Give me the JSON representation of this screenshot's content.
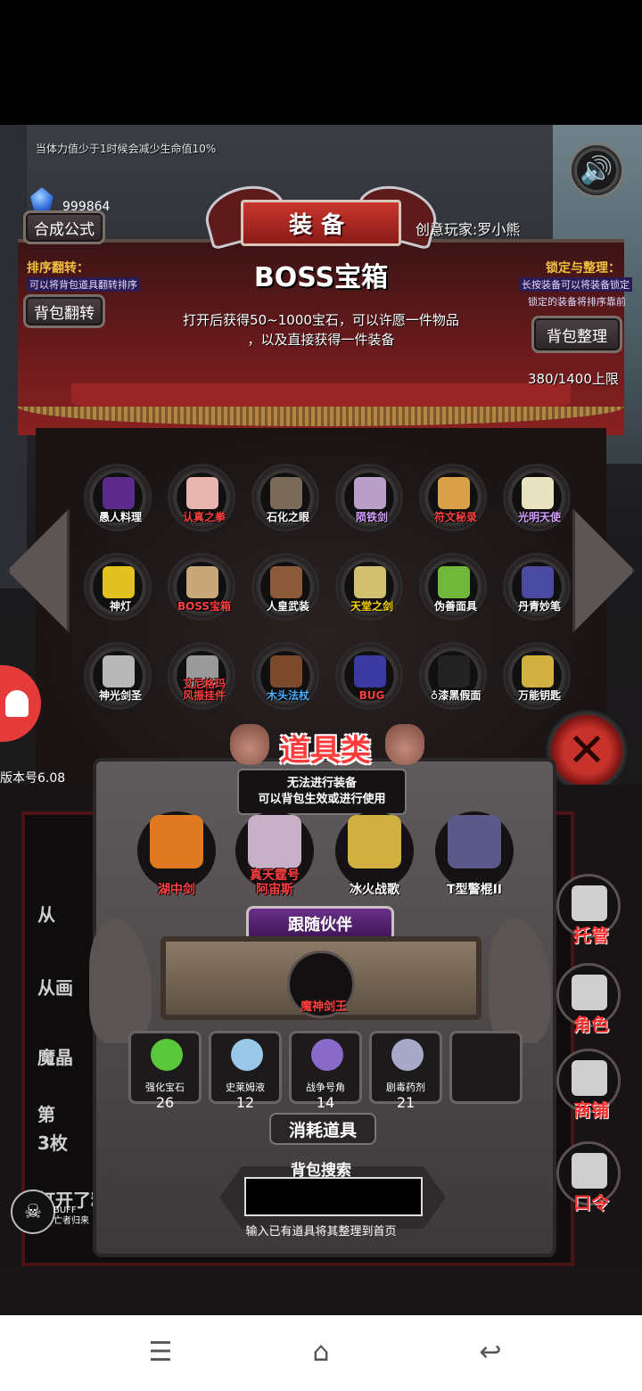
{
  "hint": "当体力值少于1时候会减少生命值10%",
  "gem_count": "999864",
  "header": {
    "title": "装备",
    "player": "创意玩家:罗小熊",
    "synth_button": "合成公式",
    "flip_button": "背包翻转",
    "sort_button": "背包整理",
    "sort_label": "排序翻转：",
    "sort_desc": "可以将背包道具翻转排序",
    "lock_label": "锁定与整理：",
    "lock_desc1": "长按装备可以将装备锁定",
    "lock_desc2": "锁定的装备将排序靠前",
    "capacity": "380/1400上限"
  },
  "selected_item": {
    "title": "BOSS宝箱",
    "desc_line1": "打开后获得50~1000宝石，可以许愿一件物品",
    "desc_line2": "，以及直接获得一件装备"
  },
  "items": [
    {
      "label": "愚人料理",
      "color": "#ffffff",
      "art": "#5b2a8a"
    },
    {
      "label": "认真之拳",
      "color": "#ff4040",
      "art": "#e7b6b0"
    },
    {
      "label": "石化之眼",
      "color": "#ffffff",
      "art": "#7a6a5a"
    },
    {
      "label": "陨铁剑",
      "color": "#d7a0ff",
      "art": "#b9a0c9"
    },
    {
      "label": "符文秘录",
      "color": "#ff4040",
      "art": "#d9a04a"
    },
    {
      "label": "光明天使",
      "color": "#d7a0ff",
      "art": "#e8e2c0"
    },
    {
      "label": "神灯",
      "color": "#ffffff",
      "art": "#e2c020"
    },
    {
      "label": "BOSS宝箱",
      "color": "#ff4040",
      "art": "#c9a878"
    },
    {
      "label": "人皇武装",
      "color": "#ffffff",
      "art": "#8a5a3a"
    },
    {
      "label": "天堂之剑",
      "color": "#ffd700",
      "art": "#d0c070"
    },
    {
      "label": "伪善面具",
      "color": "#ffffff",
      "art": "#6fb83a"
    },
    {
      "label": "丹青妙笔",
      "color": "#ffffff",
      "art": "#4a4aa0"
    },
    {
      "label": "神光剑圣",
      "color": "#ffffff",
      "art": "#b8b8b8"
    },
    {
      "label": "艾尼格玛\n风振挂件",
      "color": "#ff4040",
      "art": "#9a9a9a"
    },
    {
      "label": "木头法杖",
      "color": "#4ab0ff",
      "art": "#7a4a2a"
    },
    {
      "label": "BUG",
      "color": "#ff4040",
      "art": "#3a3aa0"
    },
    {
      "label": "♁漆黑假面",
      "color": "#ffffff",
      "art": "#222222"
    },
    {
      "label": "万能钥匙",
      "color": "#ffffff",
      "art": "#d0b040"
    }
  ],
  "version": "版本号6.08",
  "log_lines": [
    "从",
    "从画",
    "魔晶",
    "第",
    "3枚",
    "打开了精致的宝箱"
  ],
  "tools": {
    "title": "道具类",
    "desc_line1": "无法进行装备",
    "desc_line2": "可以背包生效或进行使用",
    "list": [
      {
        "label": "湖中剑",
        "color": "#ff4040",
        "art": "#e07a20"
      },
      {
        "label": "真天霆号\n阿宙斯",
        "color": "#ff4040",
        "art": "#c9b0c9"
      },
      {
        "label": "冰火战歌",
        "color": "#ffffff",
        "art": "#d0b040"
      },
      {
        "label": "T型警棍II",
        "color": "#ffffff",
        "art": "#5a5a8a"
      }
    ]
  },
  "partner": {
    "ribbon": "跟随伙伴",
    "name": "魔神剑王"
  },
  "consumables": [
    {
      "label": "强化宝石",
      "count": "26",
      "art": "#5ac83a"
    },
    {
      "label": "史莱姆液",
      "count": "12",
      "art": "#9ac8e8"
    },
    {
      "label": "战争号角",
      "count": "14",
      "art": "#8a6ac8"
    },
    {
      "label": "剧毒药剂",
      "count": "21",
      "art": "#a8a8c8"
    },
    {
      "label": "",
      "count": "",
      "art": "#1d1a1b"
    }
  ],
  "consume_button": "消耗道具",
  "search": {
    "label": "背包搜索",
    "value": "",
    "hint": "输入已有道具将其整理到首页"
  },
  "side_buttons": [
    {
      "label": "托管"
    },
    {
      "label": "角色"
    },
    {
      "label": "商铺"
    },
    {
      "label": "口令"
    }
  ],
  "buff": {
    "line1": "BUFF",
    "line2": "亡者归来"
  }
}
